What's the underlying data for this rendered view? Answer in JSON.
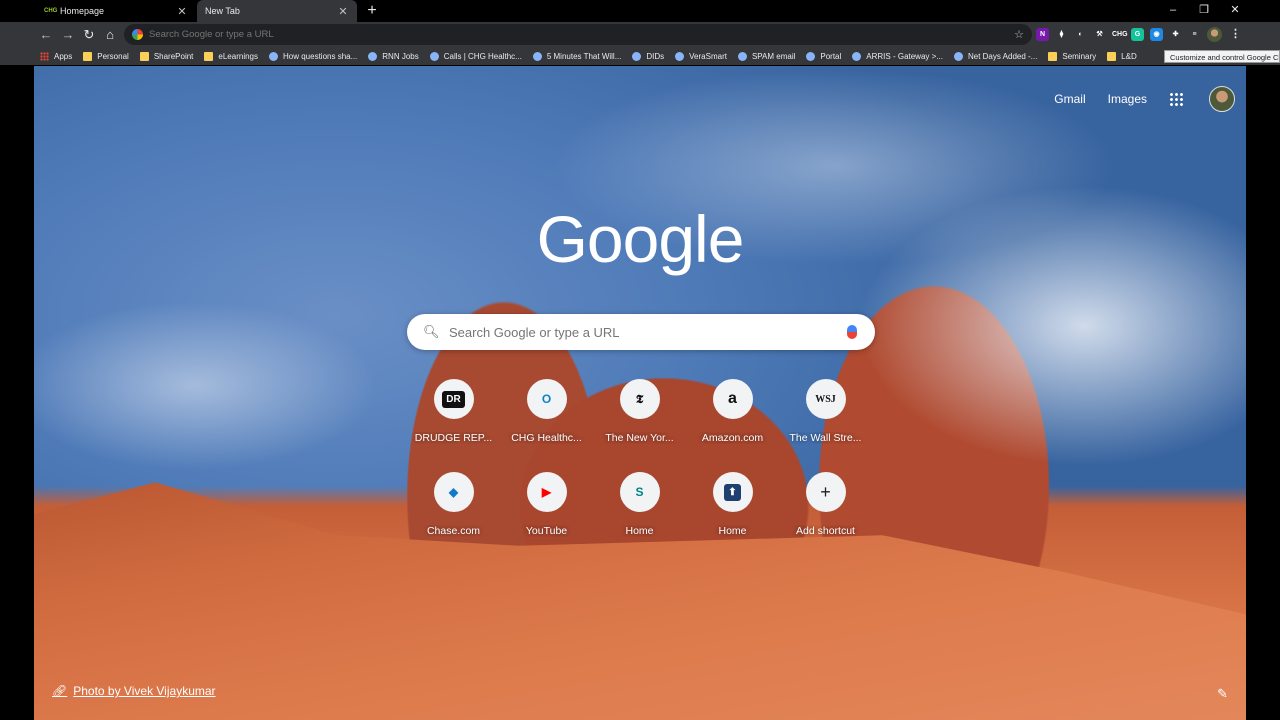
{
  "tabs": [
    {
      "title": "Homepage",
      "favicon": "CHG"
    },
    {
      "title": "New Tab"
    }
  ],
  "toolbar": {
    "omnibox_placeholder": "Search Google or type a URL"
  },
  "extensions": [
    {
      "name": "onenote-icon",
      "label": "N",
      "color": "#7719aa"
    },
    {
      "name": "dropbox-icon",
      "label": "⧫",
      "color": "#35363a"
    },
    {
      "name": "darkmode-icon",
      "label": "◐",
      "color": "#35363a"
    },
    {
      "name": "tool-icon",
      "label": "⚒",
      "color": "#35363a"
    },
    {
      "name": "chg-icon",
      "label": "CHG",
      "color": "#35363a"
    },
    {
      "name": "grammarly-icon",
      "label": "G",
      "color": "#15c39a"
    },
    {
      "name": "extension-badge-icon",
      "label": "◉",
      "color": "#1e88e5"
    },
    {
      "name": "puzzle-icon",
      "label": "✚",
      "color": "#35363a"
    },
    {
      "name": "reading-list-icon",
      "label": "≡",
      "color": "#35363a"
    }
  ],
  "bookmarks": [
    {
      "label": "Apps",
      "kind": "apps"
    },
    {
      "label": "Personal",
      "kind": "folder"
    },
    {
      "label": "SharePoint",
      "kind": "folder"
    },
    {
      "label": "eLearnings",
      "kind": "folder"
    },
    {
      "label": "How questions sha...",
      "kind": "page"
    },
    {
      "label": "RNN Jobs",
      "kind": "page"
    },
    {
      "label": "Calls | CHG Healthc...",
      "kind": "page"
    },
    {
      "label": "5 Minutes That Will...",
      "kind": "page"
    },
    {
      "label": "DIDs",
      "kind": "page"
    },
    {
      "label": "VeraSmart",
      "kind": "page"
    },
    {
      "label": "SPAM email",
      "kind": "page"
    },
    {
      "label": "Portal",
      "kind": "page"
    },
    {
      "label": "ARRIS - Gateway >...",
      "kind": "page"
    },
    {
      "label": "Net Days Added -...",
      "kind": "page"
    },
    {
      "label": "Seminary",
      "kind": "folder"
    },
    {
      "label": "L&D",
      "kind": "folder"
    }
  ],
  "tooltip": "Customize and control Google Chrome",
  "ntp": {
    "gmail": "Gmail",
    "images": "Images",
    "logo": "Google",
    "search_placeholder": "Search Google or type a URL",
    "shortcuts": [
      {
        "label": "DRUDGE REP...",
        "glyph": "DR",
        "fg": "#fff",
        "bg": "#111"
      },
      {
        "label": "CHG Healthc...",
        "glyph": "O",
        "fg": "#0a84c6",
        "bg": "#f1f3f4"
      },
      {
        "label": "The New Yor...",
        "glyph": "𝕿",
        "fg": "#111",
        "bg": "#f1f3f4"
      },
      {
        "label": "Amazon.com",
        "glyph": "a",
        "fg": "#111",
        "bg": "#f1f3f4"
      },
      {
        "label": "The Wall Stre...",
        "glyph": "WSJ",
        "fg": "#111",
        "bg": "#f1f3f4"
      },
      {
        "label": "Chase.com",
        "glyph": "◆",
        "fg": "#117aca",
        "bg": "#f1f3f4"
      },
      {
        "label": "YouTube",
        "glyph": "▶",
        "fg": "#ff0000",
        "bg": "#f1f3f4"
      },
      {
        "label": "Home",
        "glyph": "S",
        "fg": "#038387",
        "bg": "#f1f3f4"
      },
      {
        "label": "Home",
        "glyph": "⬆",
        "fg": "#fff",
        "bg": "#1f3f6e"
      },
      {
        "label": "Add shortcut",
        "glyph": "+",
        "fg": "#202124",
        "bg": "#f1f3f4"
      }
    ],
    "photo_credit": "Photo by Vivek Vijaykumar"
  }
}
